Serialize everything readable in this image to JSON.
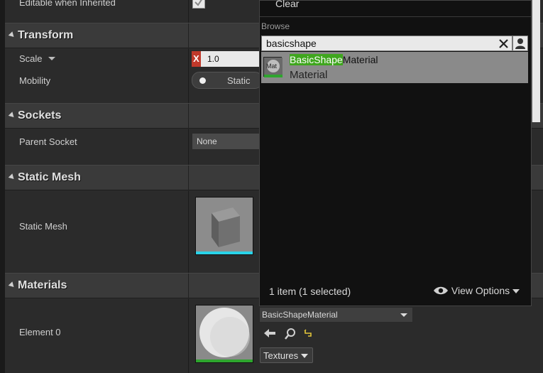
{
  "rows": {
    "editable_inherited_label": "Editable when Inherited",
    "scale_label": "Scale",
    "scale_x_badge": "X",
    "scale_x_value": "1.0",
    "mobility_label": "Mobility",
    "mobility_value": "Static",
    "parent_socket_label": "Parent Socket",
    "parent_socket_value": "None",
    "static_mesh_label": "Static Mesh",
    "element0_label": "Element 0",
    "element0_value": "BasicShapeMaterial",
    "textures_button": "Textures"
  },
  "sections": {
    "transform": "Transform",
    "sockets": "Sockets",
    "static_mesh": "Static Mesh",
    "materials": "Materials"
  },
  "popup": {
    "clear_label": "Clear",
    "browse_label": "Browse",
    "search_value": "basicshape",
    "result": {
      "match": "BasicShape",
      "rest": "Material",
      "type": "Material",
      "thumb_text": "Mat"
    },
    "status": "1 item (1 selected)",
    "view_options": "View Options"
  },
  "colors": {
    "highlight": "#3fa61e",
    "scale_x_badge": "#c0392b",
    "mesh_underline": "#29d3e8",
    "material_underline": "#2ea52e"
  },
  "icons": [
    "checkmark-icon",
    "chevron-down-icon",
    "clear-x-icon",
    "person-icon",
    "eye-icon",
    "back-arrow-icon",
    "magnifier-icon",
    "reset-arrow-icon"
  ]
}
